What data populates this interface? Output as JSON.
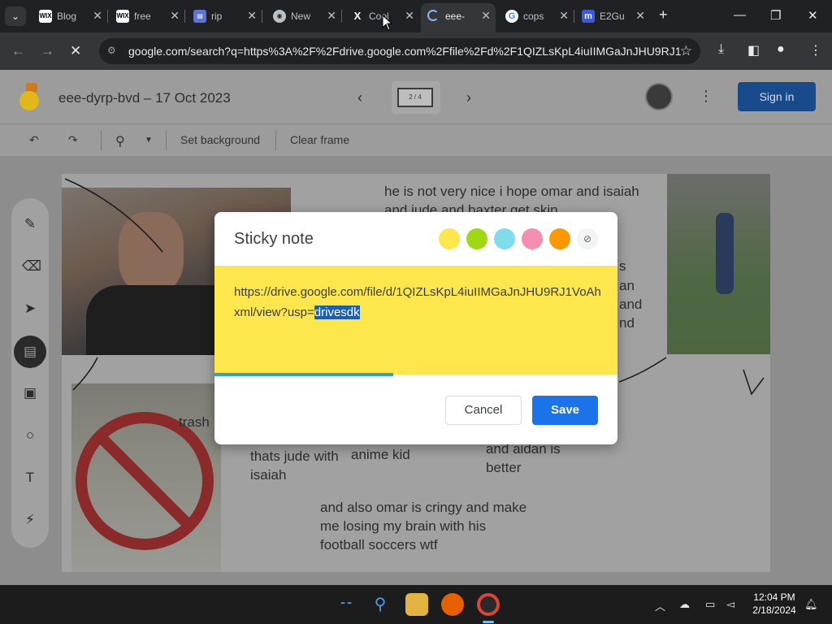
{
  "browser": {
    "tabs": [
      {
        "label": "Blog",
        "favicon": "WIX"
      },
      {
        "label": "free",
        "favicon": "WIX"
      },
      {
        "label": "rip",
        "favicon": "form-icon"
      },
      {
        "label": "New",
        "favicon": "chrome-icon"
      },
      {
        "label": "Cool",
        "favicon": "X"
      },
      {
        "label": "eee-",
        "favicon": "loading-spinner",
        "active": true
      },
      {
        "label": "cops",
        "favicon": "G"
      },
      {
        "label": "E2Gu",
        "favicon": "m"
      }
    ],
    "address": "google.com/search?q=https%3A%2F%2Fdrive.google.com%2Ffile%2Fd%2F1QIZLsKpL4iuIIMGaJnJHU9RJ1V..."
  },
  "jamboard": {
    "title": "eee-dyrp-bvd – 17 Oct 2023",
    "frame_indicator": "2 / 4",
    "signin_label": "Sign in",
    "toolbar": {
      "set_background": "Set background",
      "clear_frame": "Clear frame"
    },
    "board_texts": {
      "t1": "he is not very nice i hope omar and isaiah and jude and baxter get skin",
      "t2": "trash",
      "t3": "thats jude with isaiah",
      "t4": "anime kid",
      "t5": "and aidan is better",
      "t6": "and also omar is cringy and make me losing my brain with his football soccers wtf",
      "t7": "s",
      "t8": "an",
      "t9": "and",
      "t10": "nd"
    }
  },
  "sticky_note": {
    "title": "Sticky note",
    "colors": [
      "#fde74c",
      "#a0d911",
      "#7fdcea",
      "#f48fb1",
      "#ff9800"
    ],
    "text_before": "https://drive.google.com/file/d/1QIZLsKpL4iuIIMGaJnJHU9RJ1VoAhxml/view?usp=",
    "text_selected": "drivesdk",
    "cancel_label": "Cancel",
    "save_label": "Save"
  },
  "taskbar": {
    "time": "12:04 PM",
    "date": "2/18/2024"
  }
}
